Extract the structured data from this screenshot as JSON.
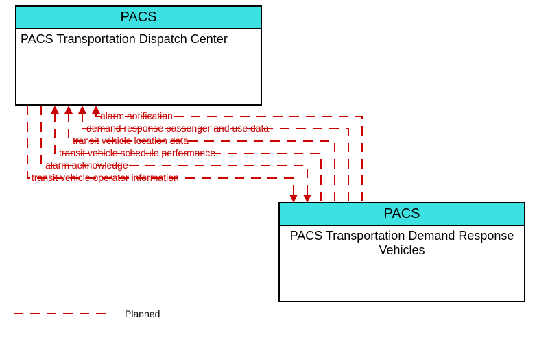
{
  "box1": {
    "header": "PACS",
    "title": "PACS Transportation Dispatch Center"
  },
  "box2": {
    "header": "PACS",
    "title": "PACS Transportation Demand Response Vehicles"
  },
  "flows": {
    "f1": "alarm notification",
    "f2": "demand response passenger and use data",
    "f3": "transit vehicle location data",
    "f4": "transit vehicle schedule performance",
    "f5": "alarm acknowledge",
    "f6": "transit vehicle operator information"
  },
  "legend": {
    "label": "Planned"
  }
}
